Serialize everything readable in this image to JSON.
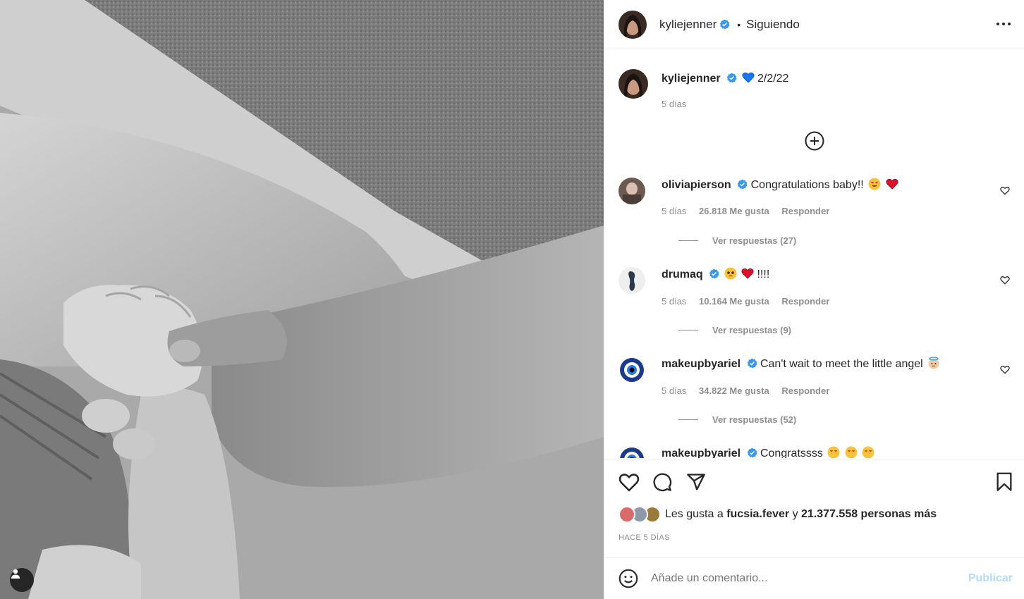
{
  "post": {
    "author": "kyliejenner",
    "follow_status": "Siguiendo",
    "caption_text": "2/2/22",
    "caption_age": "5 días",
    "more_icon": "more-horizontal-icon"
  },
  "comments": [
    {
      "username": "oliviapierson",
      "text": "Congratulations baby!!",
      "age": "5 días",
      "likes": "26.818 Me gusta",
      "reply": "Responder",
      "replies": "Ver respuestas (27)"
    },
    {
      "username": "drumaq",
      "text": "!!!!",
      "age": "5 días",
      "likes": "10.164 Me gusta",
      "reply": "Responder",
      "replies": "Ver respuestas (9)"
    },
    {
      "username": "makeupbyariel",
      "text": "Can't wait to meet the little angel",
      "age": "5 días",
      "likes": "34.822 Me gusta",
      "reply": "Responder",
      "replies": "Ver respuestas (52)"
    },
    {
      "username": "makeupbyariel",
      "text": "Congratssss"
    }
  ],
  "actions": {
    "likes_prefix": "Les gusta a",
    "likes_user": "fucsia.fever",
    "likes_joiner": "y",
    "likes_count": "21.377.558 personas más",
    "time_ago": "HACE 5 DÍAS"
  },
  "comment_box": {
    "placeholder": "Añade un comentario...",
    "publish": "Publicar"
  },
  "colors": {
    "verified": "#3897f0",
    "publish_disabled": "#b3dbff",
    "muted_text": "#8e8e8e"
  }
}
